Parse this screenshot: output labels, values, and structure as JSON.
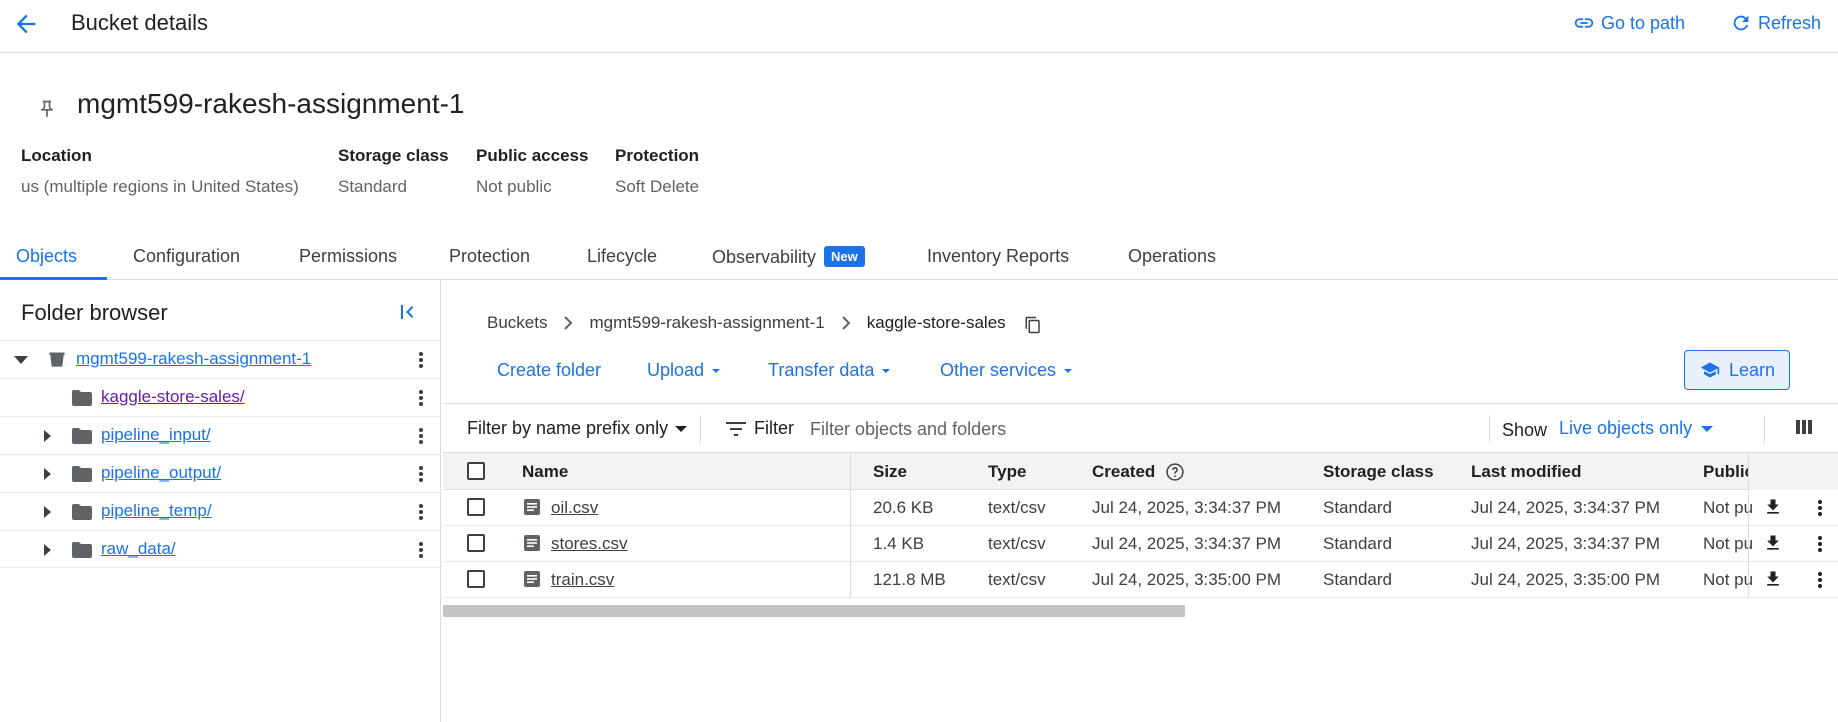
{
  "header": {
    "title": "Bucket details",
    "go_to_path": "Go to path",
    "refresh": "Refresh"
  },
  "bucket": {
    "name": "mgmt599-rakesh-assignment-1",
    "meta": [
      {
        "label": "Location",
        "value": "us (multiple regions in United States)"
      },
      {
        "label": "Storage class",
        "value": "Standard"
      },
      {
        "label": "Public access",
        "value": "Not public"
      },
      {
        "label": "Protection",
        "value": "Soft Delete"
      }
    ]
  },
  "tabs": [
    {
      "label": "Objects",
      "active": true
    },
    {
      "label": "Configuration"
    },
    {
      "label": "Permissions"
    },
    {
      "label": "Protection"
    },
    {
      "label": "Lifecycle"
    },
    {
      "label": "Observability",
      "badge": "New"
    },
    {
      "label": "Inventory Reports"
    },
    {
      "label": "Operations"
    }
  ],
  "folder_browser": {
    "title": "Folder browser",
    "root": "mgmt599-rakesh-assignment-1",
    "folders": [
      {
        "name": "kaggle-store-sales/",
        "selected": true
      },
      {
        "name": "pipeline_input/"
      },
      {
        "name": "pipeline_output/"
      },
      {
        "name": "pipeline_temp/"
      },
      {
        "name": "raw_data/"
      }
    ]
  },
  "breadcrumb": [
    "Buckets",
    "mgmt599-rakesh-assignment-1",
    "kaggle-store-sales"
  ],
  "toolbar": {
    "create_folder": "Create folder",
    "upload": "Upload",
    "transfer_data": "Transfer data",
    "other_services": "Other services",
    "learn": "Learn"
  },
  "filter": {
    "prefix_mode": "Filter by name prefix only",
    "filter_label": "Filter",
    "placeholder": "Filter objects and folders",
    "show_label": "Show",
    "show_value": "Live objects only"
  },
  "table": {
    "columns": [
      "Name",
      "Size",
      "Type",
      "Created",
      "Storage class",
      "Last modified",
      "Public"
    ],
    "rows": [
      {
        "name": "oil.csv",
        "size": "20.6 KB",
        "type": "text/csv",
        "created": "Jul 24, 2025, 3:34:37 PM",
        "storage_class": "Standard",
        "last_modified": "Jul 24, 2025, 3:34:37 PM",
        "public": "Not pu"
      },
      {
        "name": "stores.csv",
        "size": "1.4 KB",
        "type": "text/csv",
        "created": "Jul 24, 2025, 3:34:37 PM",
        "storage_class": "Standard",
        "last_modified": "Jul 24, 2025, 3:34:37 PM",
        "public": "Not pu"
      },
      {
        "name": "train.csv",
        "size": "121.8 MB",
        "type": "text/csv",
        "created": "Jul 24, 2025, 3:35:00 PM",
        "storage_class": "Standard",
        "last_modified": "Jul 24, 2025, 3:35:00 PM",
        "public": "Not pu"
      }
    ]
  },
  "colors": {
    "accent": "#1a73e8",
    "visited_link": "#681da8",
    "border": "#dadce0",
    "header_bg": "#f1f3f4"
  }
}
